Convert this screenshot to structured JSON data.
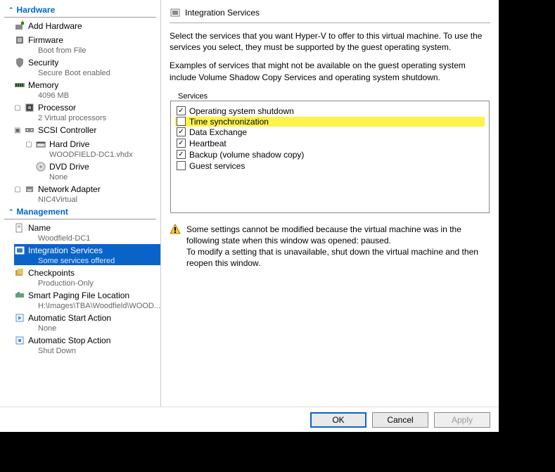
{
  "nav": {
    "hardware": {
      "title": "Hardware",
      "add_hw": "Add Hardware",
      "firmware": "Firmware",
      "firmware_sub": "Boot from File",
      "security": "Security",
      "security_sub": "Secure Boot enabled",
      "memory": "Memory",
      "memory_sub": "4096 MB",
      "processor": "Processor",
      "processor_sub": "2 Virtual processors",
      "scsi": "SCSI Controller",
      "hard_drive": "Hard Drive",
      "hard_drive_sub": "WOODFIELD-DC1.vhdx",
      "dvd": "DVD Drive",
      "dvd_sub": "None",
      "net": "Network Adapter",
      "net_sub": "NIC4Virtual"
    },
    "management": {
      "title": "Management",
      "name": "Name",
      "name_sub": "Woodfield-DC1",
      "integration": "Integration Services",
      "integration_sub": "Some services offered",
      "checkpoints": "Checkpoints",
      "checkpoints_sub": "Production-Only",
      "spf": "Smart Paging File Location",
      "spf_sub": "H:\\Images\\TBA\\Woodfield\\WOOD...",
      "auto_start": "Automatic Start Action",
      "auto_start_sub": "None",
      "auto_stop": "Automatic Stop Action",
      "auto_stop_sub": "Shut Down"
    }
  },
  "panel": {
    "title": "Integration Services",
    "intro": "Select the services that you want Hyper-V to offer to this virtual machine. To use the services you select, they must be supported by the guest operating system.",
    "examples": "Examples of services that might not be available on the guest operating system include Volume Shadow Copy Services and operating system shutdown.",
    "group_label": "Services",
    "services": [
      {
        "label": "Operating system shutdown",
        "checked": true,
        "highlight": false
      },
      {
        "label": "Time synchronization",
        "checked": false,
        "highlight": true
      },
      {
        "label": "Data Exchange",
        "checked": true,
        "highlight": false
      },
      {
        "label": "Heartbeat",
        "checked": true,
        "highlight": false
      },
      {
        "label": "Backup (volume shadow copy)",
        "checked": true,
        "highlight": false
      },
      {
        "label": "Guest services",
        "checked": false,
        "highlight": false
      }
    ],
    "warning1": "Some settings cannot be modified because the virtual machine was in the following state when this window was opened: paused.",
    "warning2": "To modify a setting that is unavailable, shut down the virtual machine and then reopen this window."
  },
  "buttons": {
    "ok": "OK",
    "cancel": "Cancel",
    "apply": "Apply"
  }
}
